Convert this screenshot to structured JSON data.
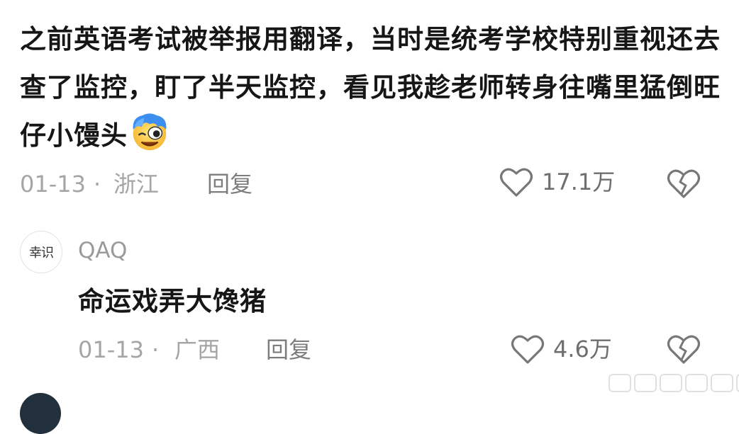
{
  "comment": {
    "text": "之前英语考试被举报用翻译，当时是统考学校特别重视还去查了监控，盯了半天监控，看见我趁老师转身往嘴里猛倒旺仔小馒头",
    "emoji": "laughing-face-emoji",
    "date": "01-13",
    "separator": "·",
    "location": "浙江",
    "reply_label": "回复",
    "likes": "17.1万"
  },
  "reply": {
    "avatar_text": "幸识",
    "username": "QAQ",
    "text": "命运戏弄大馋猪",
    "date": "01-13",
    "separator": "·",
    "location": "广西",
    "reply_label": "回复",
    "likes": "4.6万"
  },
  "icons": {
    "like": "heart-outline-icon",
    "dislike": "broken-heart-icon"
  },
  "colors": {
    "text": "#161616",
    "meta": "#a5a5a5",
    "icon": "#777777"
  }
}
